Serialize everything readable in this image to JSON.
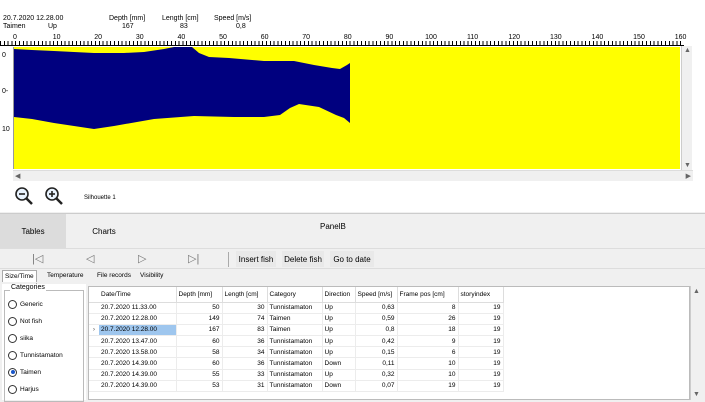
{
  "header": {
    "datetime": "20.7.2020 12.28.00",
    "species": "Taimen",
    "direction": "Up",
    "depth_label": "Depth [mm]",
    "depth_value": "167",
    "length_label": "Length [cm]",
    "length_value": "83",
    "speed_label": "Speed [m/s]",
    "speed_value": "0,8"
  },
  "ruler": [
    "0",
    "10",
    "20",
    "30",
    "40",
    "50",
    "60",
    "70",
    "80",
    "90",
    "100",
    "110",
    "120",
    "130",
    "140",
    "150",
    "160"
  ],
  "y_labels": [
    "0",
    "0-",
    "10"
  ],
  "viewer": {
    "silhouette_label": "Silhouette 1",
    "canvas_color": "#ffff00",
    "fish_color": "#00007f"
  },
  "tabs": {
    "tables": "Tables",
    "charts": "Charts"
  },
  "panel_label": "PanelB",
  "nav": {
    "first": "|◁",
    "prev": "◁",
    "next": "▷",
    "last": "▷|",
    "insert_fish": "Insert fish",
    "delete_fish": "Delete fish",
    "go_to_date": "Go to date"
  },
  "subtabs": [
    "Size/Time",
    "Temperature",
    "File records",
    "Visibility"
  ],
  "categories": {
    "legend": "Categories",
    "items": [
      "Generic",
      "Not fish",
      "siika",
      "Tunnistamaton",
      "Taimen",
      "Harjus"
    ],
    "selected": "Taimen"
  },
  "table": {
    "columns": [
      "Date/Time",
      "Depth [mm]",
      "Length [cm]",
      "Category",
      "Direction",
      "Speed [m/s]",
      "Frame pos [cm]",
      "storyindex"
    ],
    "rows": [
      [
        "20.7.2020 11.33.00",
        "50",
        "30",
        "Tunnistamaton",
        "Up",
        "0,63",
        "8",
        "19"
      ],
      [
        "20.7.2020 12.28.00",
        "149",
        "74",
        "Taimen",
        "Up",
        "0,59",
        "26",
        "19"
      ],
      [
        "20.7.2020 12.28.00",
        "167",
        "83",
        "Taimen",
        "Up",
        "0,8",
        "18",
        "19"
      ],
      [
        "20.7.2020 13.47.00",
        "60",
        "36",
        "Tunnistamaton",
        "Up",
        "0,42",
        "9",
        "19"
      ],
      [
        "20.7.2020 13.58.00",
        "58",
        "34",
        "Tunnistamaton",
        "Up",
        "0,15",
        "6",
        "19"
      ],
      [
        "20.7.2020 14.39.00",
        "60",
        "36",
        "Tunnistamaton",
        "Down",
        "0,11",
        "10",
        "19"
      ],
      [
        "20.7.2020 14.39.00",
        "55",
        "33",
        "Tunnistamaton",
        "Up",
        "0,32",
        "10",
        "19"
      ],
      [
        "20.7.2020 14.39.00",
        "53",
        "31",
        "Tunnistamaton",
        "Down",
        "0,07",
        "19",
        "19"
      ]
    ],
    "selected_row": 2,
    "row_indicator": "›"
  }
}
